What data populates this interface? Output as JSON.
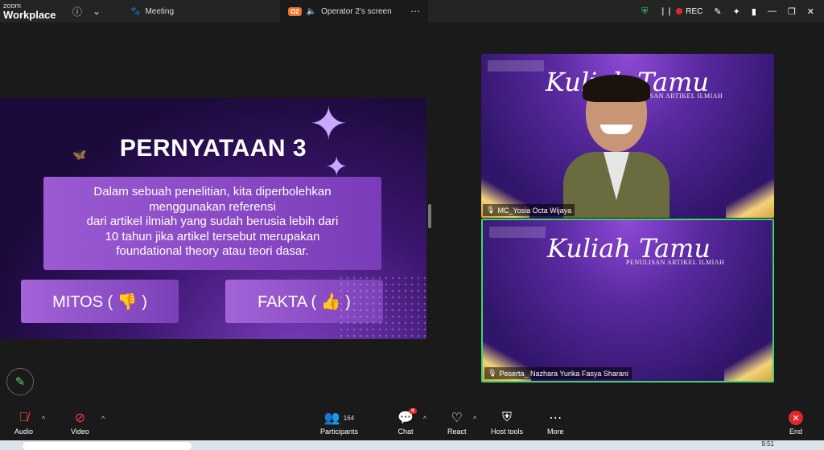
{
  "topbar": {
    "brand_top": "zoom",
    "brand_bottom": "Workplace",
    "meeting_tab": "Meeting",
    "screen_badge": "O2",
    "screen_tab": "Operator 2's screen",
    "rec_label": "REC"
  },
  "slide": {
    "title": "PERNYATAAN 3",
    "statement_lines": [
      "Dalam sebuah penelitian, kita diperbolehkan",
      "menggunakan referensi",
      "dari artikel ilmiah yang sudah berusia lebih dari",
      "10 tahun jika artikel tersebut merupakan",
      "foundational theory atau teori dasar."
    ],
    "option_mitos": "MITOS ( 👎 )",
    "option_fakta": "FAKTA ( 👍 )"
  },
  "tiles": [
    {
      "title": "Kuliah Tamu",
      "subtitle": "PENULISAN ARTIKEL ILMIAH",
      "name": "MC_Yosia Octa Wijaya"
    },
    {
      "title": "Kuliah Tamu",
      "subtitle": "PENULISAN ARTIKEL ILMIAH",
      "name": "Peserta_ Nazhara Yurika Fasya Sharani"
    }
  ],
  "toolbar": {
    "audio": "Audio",
    "video": "Video",
    "participants": "Participants",
    "participants_count": "164",
    "chat": "Chat",
    "chat_badge": "4",
    "react": "React",
    "host_tools": "Host tools",
    "more": "More",
    "end": "End"
  },
  "taskbar": {
    "time": "9:51"
  },
  "colors": {
    "active_speaker": "#3ed46e",
    "rec": "#e02828",
    "end": "#e02828"
  }
}
